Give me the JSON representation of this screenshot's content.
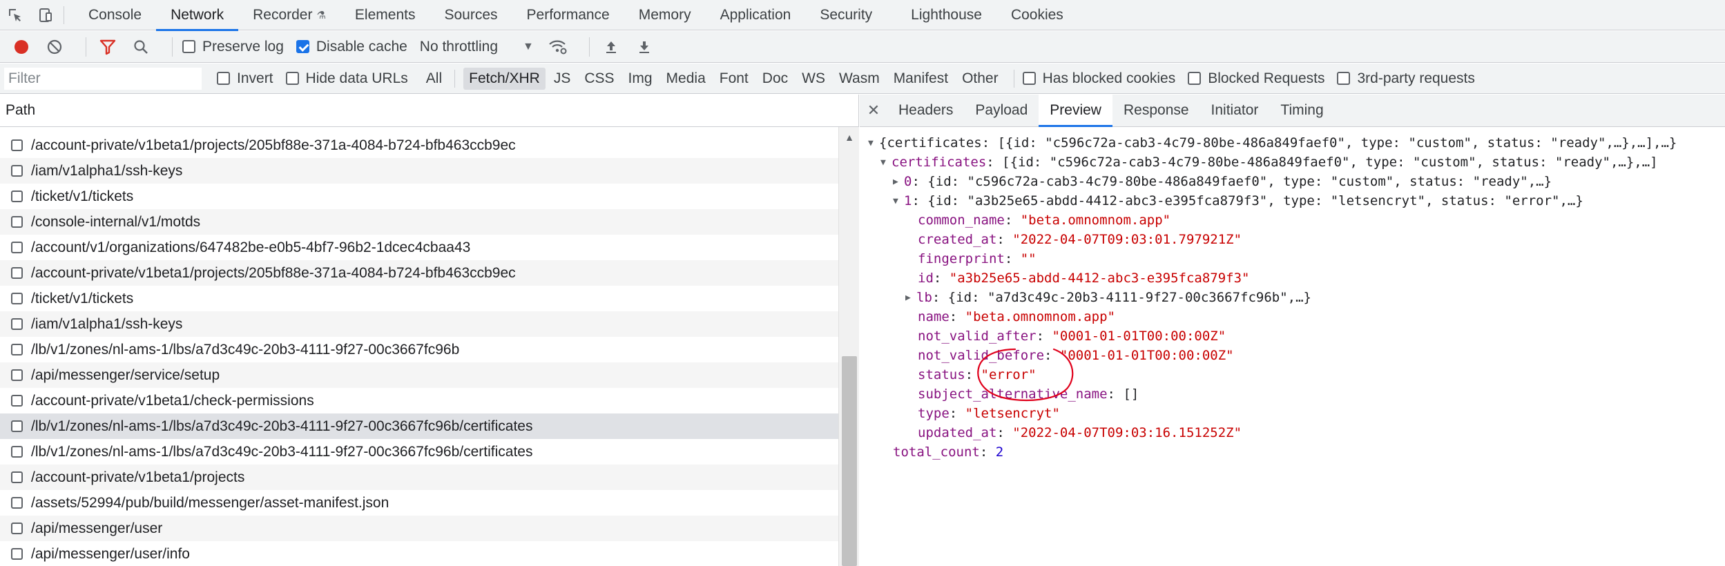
{
  "top_tabs": [
    {
      "label": "Console",
      "active": false
    },
    {
      "label": "Network",
      "active": true
    },
    {
      "label": "Recorder",
      "active": false
    },
    {
      "label": "Elements",
      "active": false
    },
    {
      "label": "Sources",
      "active": false
    },
    {
      "label": "Performance",
      "active": false
    },
    {
      "label": "Memory",
      "active": false
    },
    {
      "label": "Application",
      "active": false
    },
    {
      "label": "Security",
      "active": false
    },
    {
      "label": "Lighthouse",
      "active": false
    },
    {
      "label": "Cookies",
      "active": false
    }
  ],
  "toolbar": {
    "preserve_log": "Preserve log",
    "preserve_log_checked": false,
    "disable_cache": "Disable cache",
    "disable_cache_checked": true,
    "throttling": "No throttling"
  },
  "filterbar": {
    "placeholder": "Filter",
    "invert": "Invert",
    "hide_data_urls": "Hide data URLs",
    "types": [
      "All",
      "Fetch/XHR",
      "JS",
      "CSS",
      "Img",
      "Media",
      "Font",
      "Doc",
      "WS",
      "Wasm",
      "Manifest",
      "Other"
    ],
    "active_type": "Fetch/XHR",
    "has_blocked_cookies": "Has blocked cookies",
    "blocked_requests": "Blocked Requests",
    "third_party": "3rd-party requests"
  },
  "list": {
    "header": "Path",
    "rows": [
      "/account-private/v1beta1/projects/205bf88e-371a-4084-b724-bfb463ccb9ec",
      "/iam/v1alpha1/ssh-keys",
      "/ticket/v1/tickets",
      "/console-internal/v1/motds",
      "/account/v1/organizations/647482be-e0b5-4bf7-96b2-1dcec4cbaa43",
      "/account-private/v1beta1/projects/205bf88e-371a-4084-b724-bfb463ccb9ec",
      "/ticket/v1/tickets",
      "/iam/v1alpha1/ssh-keys",
      "/lb/v1/zones/nl-ams-1/lbs/a7d3c49c-20b3-4111-9f27-00c3667fc96b",
      "/api/messenger/service/setup",
      "/account-private/v1beta1/check-permissions",
      "/lb/v1/zones/nl-ams-1/lbs/a7d3c49c-20b3-4111-9f27-00c3667fc96b/certificates",
      "/lb/v1/zones/nl-ams-1/lbs/a7d3c49c-20b3-4111-9f27-00c3667fc96b/certificates",
      "/account-private/v1beta1/projects",
      "/assets/52994/pub/build/messenger/asset-manifest.json",
      "/api/messenger/user",
      "/api/messenger/user/info"
    ],
    "selected_index": 11
  },
  "detail_tabs": [
    {
      "label": "Headers",
      "active": false
    },
    {
      "label": "Payload",
      "active": false
    },
    {
      "label": "Preview",
      "active": true
    },
    {
      "label": "Response",
      "active": false
    },
    {
      "label": "Initiator",
      "active": false
    },
    {
      "label": "Timing",
      "active": false
    }
  ],
  "preview": {
    "root_summary": "{certificates: [{id: \"c596c72a-cab3-4c79-80be-486a849faef0\", type: \"custom\", status: \"ready\",…},…],…}",
    "certificates_key": "certificates",
    "certificates_summary": "[{id: \"c596c72a-cab3-4c79-80be-486a849faef0\", type: \"custom\", status: \"ready\",…},…]",
    "item0_key": "0",
    "item0_summary": "{id: \"c596c72a-cab3-4c79-80be-486a849faef0\", type: \"custom\", status: \"ready\",…}",
    "item1_key": "1",
    "item1_summary": "{id: \"a3b25e65-abdd-4412-abc3-e395fca879f3\", type: \"letsencryt\", status: \"error\",…}",
    "fields": {
      "common_name": "\"beta.omnomnom.app\"",
      "created_at": "\"2022-04-07T09:03:01.797921Z\"",
      "fingerprint": "\"\"",
      "id": "\"a3b25e65-abdd-4412-abc3-e395fca879f3\"",
      "lb_summary": "{id: \"a7d3c49c-20b3-4111-9f27-00c3667fc96b\",…}",
      "name": "\"beta.omnomnom.app\"",
      "not_valid_after": "\"0001-01-01T00:00:00Z\"",
      "not_valid_before": "\"0001-01-01T00:00:00Z\"",
      "status": "\"error\"",
      "subject_alternative_name": "[]",
      "type": "\"letsencryt\"",
      "updated_at": "\"2022-04-07T09:03:16.151252Z\""
    },
    "total_count_key": "total_count",
    "total_count": "2"
  },
  "colors": {
    "accent": "#1a73e8",
    "record": "#d93025",
    "filter_active": "#d93025",
    "json_key": "#881280",
    "json_string": "#c80000",
    "json_number": "#1c00cf",
    "annotation": "#e0001b"
  }
}
